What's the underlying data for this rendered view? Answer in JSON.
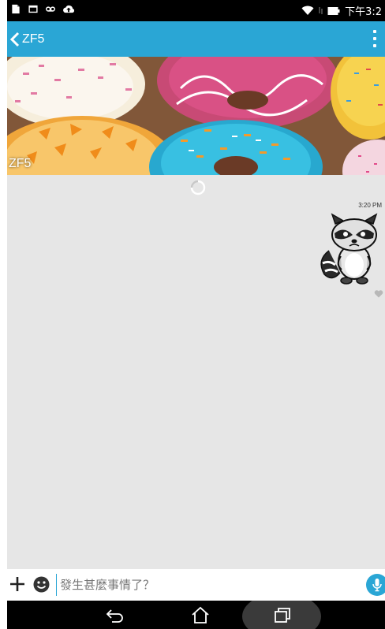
{
  "status_bar": {
    "time": "下午3:2",
    "left_icons": [
      "document-icon",
      "image-icon",
      "voicemail-icon",
      "cloud-upload-icon"
    ],
    "right_icons": [
      "wifi-icon",
      "battery-icon"
    ]
  },
  "app_bar": {
    "title": "ZF5",
    "color": "#2aa6d5"
  },
  "banner": {
    "name": "ZF5",
    "image": "donuts-photo"
  },
  "chat": {
    "messages": [
      {
        "type": "sticker",
        "sticker": "raccoon-sticker",
        "time": "3:20 PM",
        "outgoing": true
      }
    ]
  },
  "input_bar": {
    "placeholder": "發生甚麼事情了？",
    "value": ""
  },
  "nav_bar": {
    "buttons": [
      "back-icon",
      "home-icon",
      "recent-apps-icon"
    ]
  }
}
